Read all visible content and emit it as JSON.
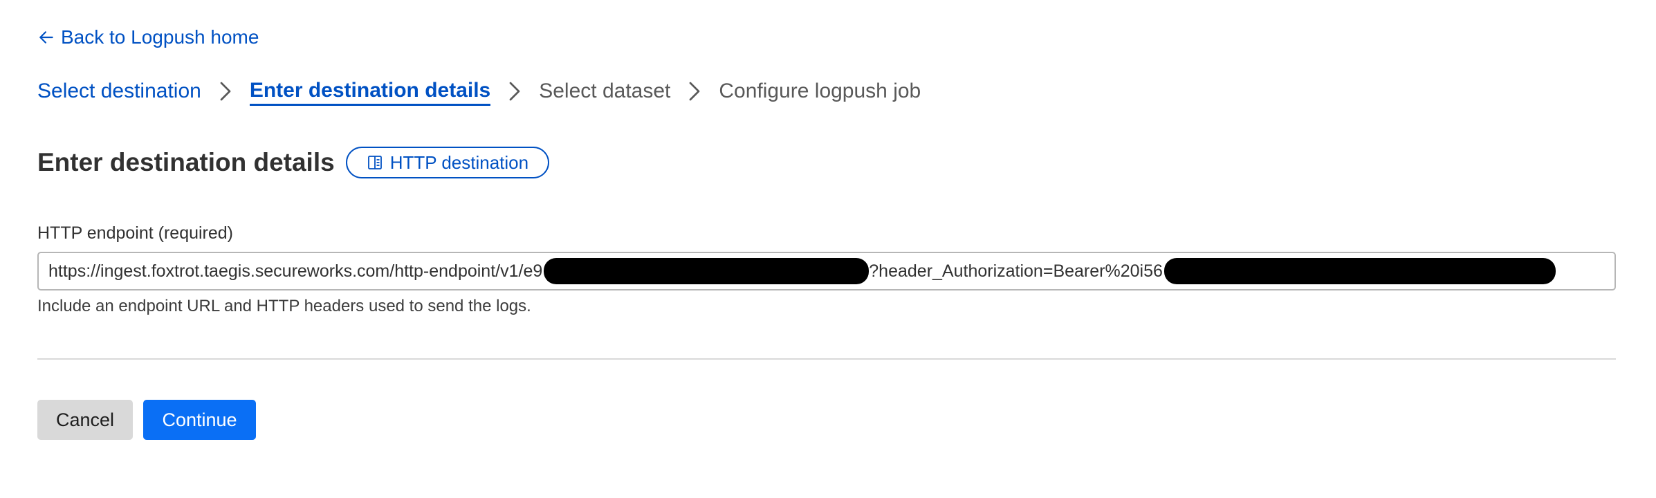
{
  "nav": {
    "back_label": "Back to Logpush home"
  },
  "stepper": {
    "steps": [
      {
        "label": "Select destination",
        "state": "done"
      },
      {
        "label": "Enter destination details",
        "state": "current"
      },
      {
        "label": "Select dataset",
        "state": "future"
      },
      {
        "label": "Configure logpush job",
        "state": "future"
      }
    ]
  },
  "section": {
    "title": "Enter destination details",
    "doc_link_label": "HTTP destination"
  },
  "endpoint_field": {
    "label": "HTTP endpoint (required)",
    "value_part1": "https://ingest.foxtrot.taegis.secureworks.com/http-endpoint/v1/e9",
    "value_part2": "?header_Authorization=Bearer%20i56",
    "help_text": "Include an endpoint URL and HTTP headers used to send the logs."
  },
  "actions": {
    "cancel_label": "Cancel",
    "continue_label": "Continue"
  },
  "colors": {
    "link": "#0051c3",
    "primary_button": "#0a6ff5",
    "secondary_button": "#d9d9d9",
    "redaction": "#000000"
  },
  "icons": {
    "back": "arrow-left-icon",
    "step_separator": "chevron-right-icon",
    "doc": "book-icon"
  }
}
